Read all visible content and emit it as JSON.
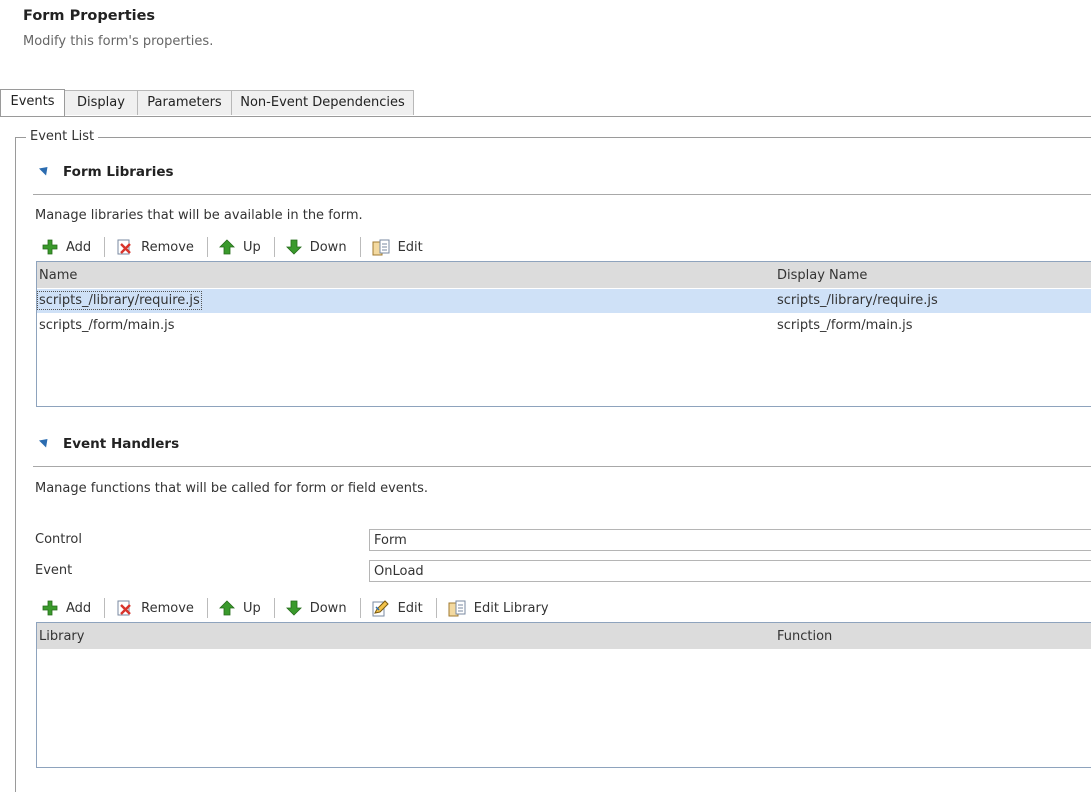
{
  "header": {
    "title": "Form Properties",
    "subtitle": "Modify this form's properties."
  },
  "tabs": [
    {
      "label": "Events",
      "active": true
    },
    {
      "label": "Display",
      "active": false
    },
    {
      "label": "Parameters",
      "active": false
    },
    {
      "label": "Non-Event Dependencies",
      "active": false
    }
  ],
  "event_list": {
    "legend": "Event List"
  },
  "form_libraries": {
    "title": "Form Libraries",
    "description": "Manage libraries that will be available in the form.",
    "toolbar": {
      "add": "Add",
      "remove": "Remove",
      "up": "Up",
      "down": "Down",
      "edit": "Edit"
    },
    "columns": {
      "name": "Name",
      "display_name": "Display Name"
    },
    "rows": [
      {
        "name": "scripts_/library/require.js",
        "display_name": "scripts_/library/require.js",
        "selected": true
      },
      {
        "name": "scripts_/form/main.js",
        "display_name": "scripts_/form/main.js",
        "selected": false
      }
    ]
  },
  "event_handlers": {
    "title": "Event Handlers",
    "description": "Manage functions that will be called for form or field events.",
    "control_label": "Control",
    "control_value": "Form",
    "event_label": "Event",
    "event_value": "OnLoad",
    "toolbar": {
      "add": "Add",
      "remove": "Remove",
      "up": "Up",
      "down": "Down",
      "edit": "Edit",
      "edit_library": "Edit Library"
    },
    "columns": {
      "library": "Library",
      "function": "Function"
    }
  },
  "colors": {
    "accent": "#2b6cb0",
    "selected_row": "#cfe1f7",
    "add_icon": "#3a9a2c",
    "remove_icon": "#d8342c"
  }
}
